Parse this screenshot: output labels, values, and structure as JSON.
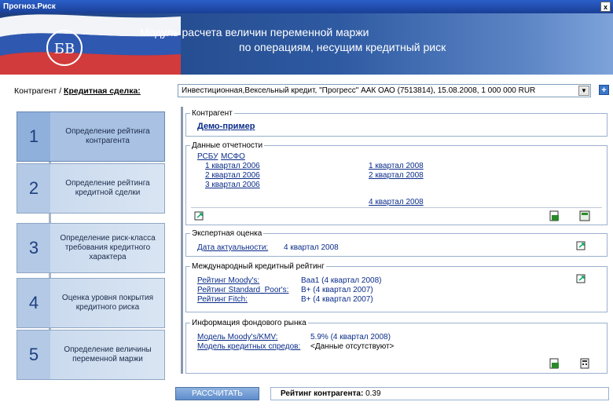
{
  "window": {
    "title": "Прогноз.Риск",
    "close_label": "x"
  },
  "banner": {
    "line1": "Модуль расчета величин переменной маржи",
    "line2": "по операциям, несущим кредитный риск"
  },
  "contractor_row": {
    "label_plain": "Контрагент / ",
    "label_bold": "Кредитная сделка:",
    "deal_value": "Инвестиционная,Вексельный кредит, \"Прогресс\" ААК ОАО (7513814), 15.08.2008, 1 000 000 RUR",
    "dropdown_arrow": "▼",
    "add_label": "+"
  },
  "steps": [
    {
      "num": "1",
      "label": "Определение рейтинга контрагента"
    },
    {
      "num": "2",
      "label": "Определение рейтинга кредитной сделки"
    },
    {
      "num": "3",
      "label": "Определение риск-класса требования кредитного характера"
    },
    {
      "num": "4",
      "label": "Оценка уровня покрытия кредитного риска"
    },
    {
      "num": "5",
      "label": "Определение величины переменной маржи"
    }
  ],
  "panels": {
    "kontragent": {
      "legend": "Контрагент",
      "value": "Демо-пример"
    },
    "reporting": {
      "legend": "Данные отчетности",
      "tabs": [
        "РСБУ",
        "МСФО"
      ],
      "col1": [
        "1 квартал 2006",
        "2 квартал 2006",
        "3 квартал 2006"
      ],
      "col2": [
        "1 квартал 2008",
        "2 квартал 2008",
        "4 квартал 2008"
      ]
    },
    "expert": {
      "legend": "Экспертная оценка",
      "label": "Дата актуальности:",
      "value": "4 квартал 2008"
    },
    "intl": {
      "legend": "Международный кредитный рейтинг",
      "rows": [
        {
          "label": "Рейтинг Moody's:",
          "value": "Baa1 (4 квартал 2008)"
        },
        {
          "label": "Рейтинг Standard_Poor's:",
          "value": "B+ (4 квартал 2007)"
        },
        {
          "label": "Рейтинг Fitch:",
          "value": "B+ (4 квартал 2007)"
        }
      ]
    },
    "market": {
      "legend": "Информация фондового рынка",
      "rows": [
        {
          "label": "Модель Moody's/KMV:",
          "value": "5.9% (4 квартал 2008)"
        },
        {
          "label": "Модель кредитных спредов:",
          "value": "<Данные отсутствуют>"
        }
      ]
    }
  },
  "bottom": {
    "calc_label": "РАССЧИТАТЬ",
    "rating_label": "Рейтинг контрагента:",
    "rating_value": "0.39"
  },
  "icons": [
    "refresh-icon",
    "export-excel-icon",
    "chart-icon",
    "calculator-icon"
  ]
}
